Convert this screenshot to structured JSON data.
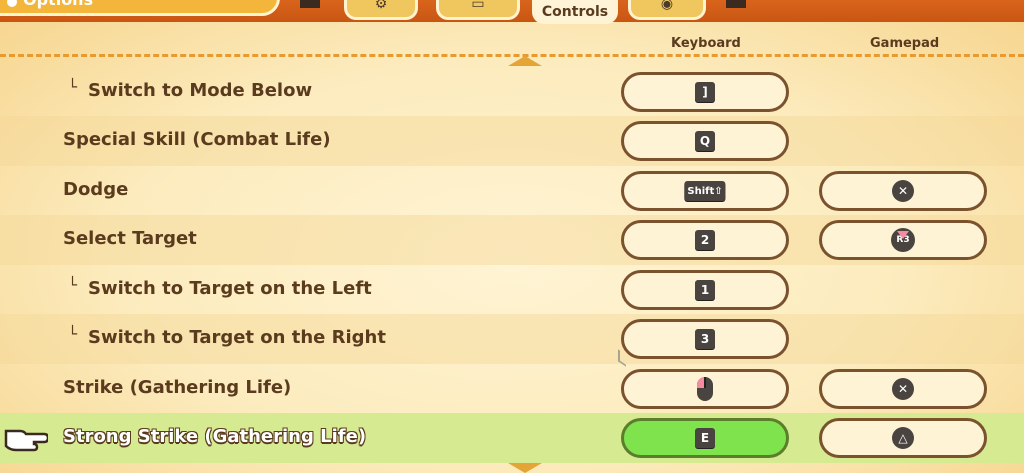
{
  "header": {
    "title": "Options",
    "active_tab_label": "Controls",
    "columns": {
      "keyboard": "Keyboard",
      "gamepad": "Gamepad"
    }
  },
  "rows": [
    {
      "sub": true,
      "label": "Switch to Mode Below",
      "keyboard": "]",
      "gamepad": null,
      "alt": false,
      "selected": false
    },
    {
      "sub": false,
      "label": "Special Skill (Combat Life)",
      "keyboard": "Q",
      "gamepad": null,
      "alt": true,
      "selected": false
    },
    {
      "sub": false,
      "label": "Dodge",
      "keyboard": "Shift⇧",
      "gamepad": "cross",
      "alt": false,
      "selected": false
    },
    {
      "sub": false,
      "label": "Select Target",
      "keyboard": "2",
      "gamepad": "R3",
      "alt": true,
      "selected": false
    },
    {
      "sub": true,
      "label": "Switch to Target on the Left",
      "keyboard": "1",
      "gamepad": null,
      "alt": false,
      "selected": false
    },
    {
      "sub": true,
      "label": "Switch to Target on the Right",
      "keyboard": "3",
      "gamepad": null,
      "alt": true,
      "selected": false
    },
    {
      "sub": false,
      "label": "Strike (Gathering Life)",
      "keyboard": "mouse-left",
      "gamepad": "cross",
      "alt": false,
      "selected": false
    },
    {
      "sub": false,
      "label": "Strong Strike (Gathering Life)",
      "keyboard": "E",
      "gamepad": "triangle",
      "alt": false,
      "selected": true
    }
  ],
  "sub_marker": "└",
  "icons": {
    "cross": "✕",
    "triangle": "△",
    "r3": "R3"
  },
  "colors": {
    "accent_orange": "#d9641c",
    "selected_row": "#d6ea92",
    "selected_pill": "#7fe34e",
    "text_brown": "#5a3b1e"
  }
}
